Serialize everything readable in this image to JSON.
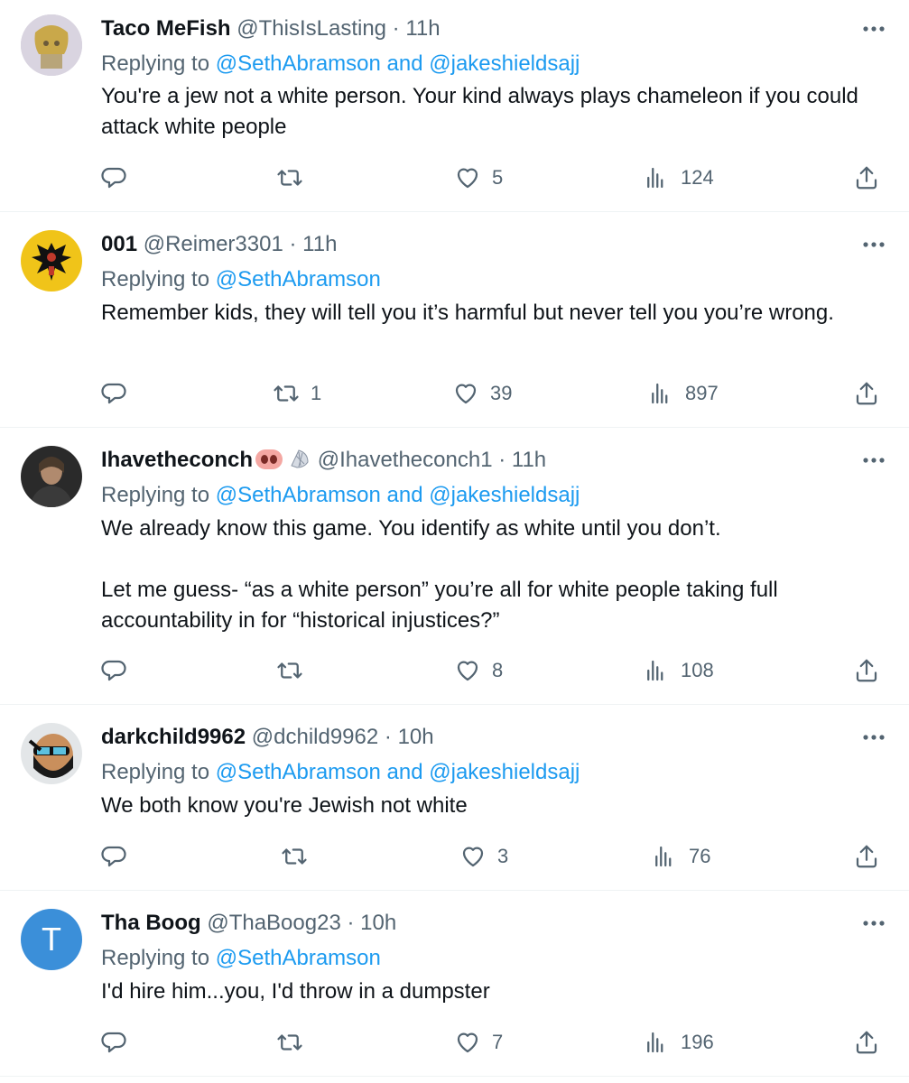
{
  "tweets": [
    {
      "name": "Taco MeFish",
      "handle": "@ThisIsLasting",
      "sep": " · ",
      "time": "11h",
      "replying_prefix": "Replying to ",
      "mention1": "@SethAbramson",
      "and": " and ",
      "mention2": "@jakeshieldsajj",
      "text": "You're a jew not a white person. Your kind always plays chameleon if you could attack white people",
      "reply_count": "",
      "retweet_count": "",
      "like_count": "5",
      "view_count": "124"
    },
    {
      "name": "001",
      "handle": "@Reimer3301",
      "sep": " · ",
      "time": "11h",
      "replying_prefix": "Replying to ",
      "mention1": "@SethAbramson",
      "text": "Remember kids, they will tell you it’s harmful but never tell you you’re wrong.",
      "reply_count": "",
      "retweet_count": "1",
      "like_count": "39",
      "view_count": "897"
    },
    {
      "name": "Ihavetheconch",
      "handle": "@Ihavetheconch1",
      "sep": " · ",
      "time": "11h",
      "replying_prefix": "Replying to ",
      "mention1": "@SethAbramson",
      "and": " and ",
      "mention2": "@jakeshieldsajj",
      "text": "We already know this game. You identify as white until you don’t.\n\nLet me guess- “as a white person” you’re all for white people taking full accountability in for “historical injustices?”",
      "reply_count": "",
      "retweet_count": "",
      "like_count": "8",
      "view_count": "108"
    },
    {
      "name": "darkchild9962",
      "handle": "@dchild9962",
      "sep": " · ",
      "time": "10h",
      "replying_prefix": "Replying to ",
      "mention1": "@SethAbramson",
      "and": " and ",
      "mention2": "@jakeshieldsajj",
      "text": "We both know you're Jewish not white",
      "reply_count": "",
      "retweet_count": "",
      "like_count": "3",
      "view_count": "76"
    },
    {
      "name": "Tha Boog",
      "handle": "@ThaBoog23",
      "sep": " · ",
      "time": "10h",
      "replying_prefix": "Replying to ",
      "mention1": "@SethAbramson",
      "text": "I'd hire him...you, I'd throw in a dumpster",
      "avatar_letter": "T",
      "reply_count": "",
      "retweet_count": "",
      "like_count": "7",
      "view_count": "196"
    }
  ],
  "colors": {
    "text": "#0f1419",
    "muted": "#536471",
    "mention": "#1d9bf0",
    "divider": "#eff3f4",
    "default_avatar": "#3b8fd9"
  },
  "icons": {
    "reply": "reply-icon",
    "retweet": "retweet-icon",
    "like": "like-icon",
    "views": "views-icon",
    "share": "share-icon",
    "more": "more-icon"
  }
}
